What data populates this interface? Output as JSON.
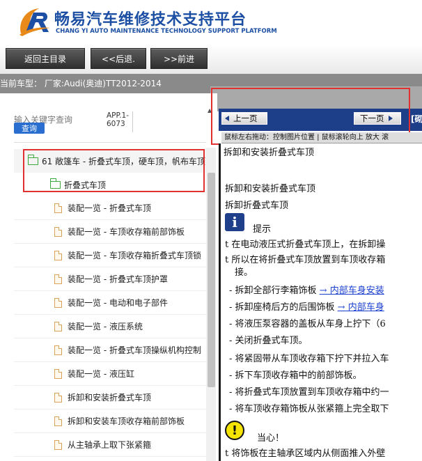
{
  "brand": {
    "title_cn": "畅易汽车维修技术支持平台",
    "title_en": "CHANG YI AUTO MAINTENANCE TECHNOLOGY SUPPORT PLATFORM",
    "accent_color": "#1c4fa3"
  },
  "toolbar": {
    "home_label": "返回主目录",
    "back_label": "<<后退.",
    "forward_label": ">>前进"
  },
  "vehicle": {
    "label": "当前车型： 厂家:Audi(奥迪)TT2012-2014"
  },
  "search": {
    "placeholder": "输入关键字查询",
    "button_label": "查询",
    "app_code": "APP.1-6073"
  },
  "tree": {
    "root": "61 敞篷车 - 折叠式车顶，硬车顶，帆布车顶",
    "folder": "折叠式车顶",
    "items": [
      "装配一览 - 折叠式车顶",
      "装配一览 - 车顶收存箱前部饰板",
      "装配一览 - 车顶收存箱折叠式车顶锁",
      "装配一览 - 折叠式车顶护罩",
      "装配一览 - 电动和电子部件",
      "装配一览 - 液压系统",
      "装配一览 - 折叠式车顶操纵机构控制",
      "装配一览 - 液压缸",
      "拆卸和安装折叠式车顶",
      "拆卸和安装车顶收存箱前部饰板",
      "从主轴承上取下张紧箍"
    ]
  },
  "pager": {
    "prev_label": "上一页",
    "next_label": "下一页",
    "extra": "[砌",
    "hint": "鼠标左右拖动：控制图片位置 | 鼠标滚轮向上 放大  滚"
  },
  "document": {
    "heading": "拆卸和安装折叠式车顶",
    "subheading": "拆卸和安装折叠式车顶",
    "subheading2": "拆卸折叠式车顶",
    "note_label": "提示",
    "note_lines": [
      "t 在电动液压式折叠式车顶上，在拆卸操",
      "t 所以在将折叠式车顶放置到车顶收存箱",
      "接。"
    ],
    "steps": [
      {
        "text": "- 拆卸全部行李箱饰板 ",
        "link": "→ 内部车身安装"
      },
      {
        "text": "- 拆卸座椅后方的后围饰板 ",
        "link": "→ 内部车身"
      },
      {
        "text": "- 将液压泵容器的盖板从车身上拧下（6",
        "link": ""
      },
      {
        "text": "- 关闭折叠式车顶。",
        "link": ""
      },
      {
        "text": "- 将紧固带从车顶收存箱下拧下并拉入车",
        "link": ""
      },
      {
        "text": "- 拆下车顶收存箱中的前部饰板。",
        "link": ""
      },
      {
        "text": "- 将折叠式车顶放置到车顶收存箱中约一",
        "link": ""
      },
      {
        "text": "- 将车顶收存箱饰板从张紧箍上完全取下",
        "link": ""
      }
    ],
    "caution_label": "当心！",
    "caution_line": "t 将饰板在主轴承区域内从侧面推入外壁"
  }
}
